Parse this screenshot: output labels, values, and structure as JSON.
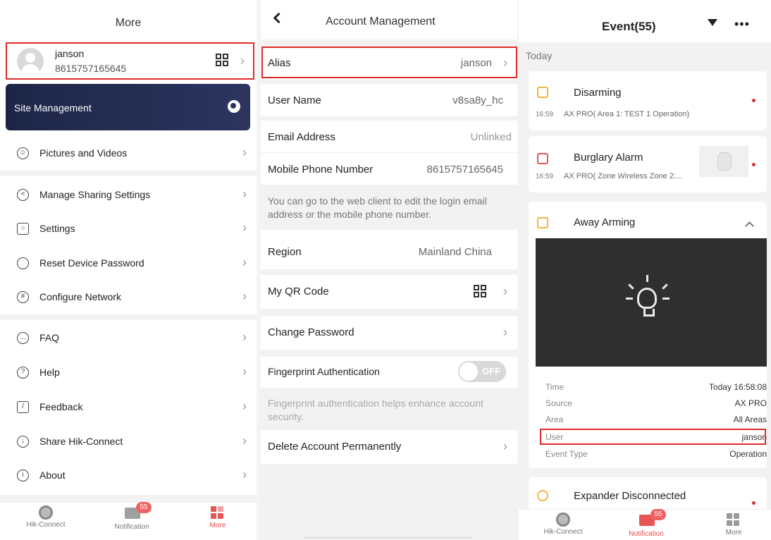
{
  "more_panel": {
    "title": "More",
    "profile": {
      "name": "janson",
      "phone": "8615757165645"
    },
    "site_management": "Site Management",
    "menu": [
      {
        "label": "Pictures and Videos",
        "icon": "image-icon"
      },
      {
        "label": "Manage Sharing Settings",
        "icon": "share-icon"
      },
      {
        "label": "Settings",
        "icon": "settings-icon"
      },
      {
        "label": "Reset Device Password",
        "icon": "reset-icon"
      },
      {
        "label": "Configure Network",
        "icon": "network-icon"
      },
      {
        "label": "FAQ",
        "icon": "faq-icon"
      },
      {
        "label": "Help",
        "icon": "help-icon"
      },
      {
        "label": "Feedback",
        "icon": "feedback-icon"
      },
      {
        "label": "Share Hik-Connect",
        "icon": "share-app-icon"
      },
      {
        "label": "About",
        "icon": "about-icon"
      }
    ],
    "tabs": [
      {
        "label": "Hik-Connect"
      },
      {
        "label": "Notification",
        "badge": "55"
      },
      {
        "label": "More"
      }
    ]
  },
  "account_panel": {
    "title": "Account Management",
    "alias": {
      "label": "Alias",
      "value": "janson"
    },
    "username": {
      "label": "User Name",
      "value": "v8sa8y_hc"
    },
    "email": {
      "label": "Email Address",
      "value": "Unlinked"
    },
    "mobile": {
      "label": "Mobile Phone Number",
      "value": "8615757165645"
    },
    "edit_note": "You can go to the web client to edit the login email address or the mobile phone number.",
    "region": {
      "label": "Region",
      "value": "Mainland China"
    },
    "qr": {
      "label": "My QR Code"
    },
    "change_password": "Change Password",
    "fingerprint": {
      "label": "Fingerprint Authentication",
      "state": "OFF"
    },
    "fingerprint_note": "Fingerprint authentication helps enhance account security.",
    "delete": "Delete Account Permanently"
  },
  "event_panel": {
    "title": "Event(55)",
    "section": "Today",
    "events": [
      {
        "title": "Disarming",
        "time": "16:59",
        "desc": "AX PRO( Area 1: TEST 1 Operation)"
      },
      {
        "title": "Burglary Alarm",
        "time": "16:59",
        "desc": "AX PRO( Zone Wireless Zone 2:..."
      },
      {
        "title": "Away Arming"
      },
      {
        "title": "Expander Disconnected"
      }
    ],
    "details": [
      {
        "key": "Time",
        "value": "Today 16:58:08"
      },
      {
        "key": "Source",
        "value": "AX PRO"
      },
      {
        "key": "Area",
        "value": "All Areas"
      },
      {
        "key": "User",
        "value": "janson"
      },
      {
        "key": "Event Type",
        "value": "Operation"
      }
    ],
    "tabs": [
      {
        "label": "Hik-Connect"
      },
      {
        "label": "Notification",
        "badge": "55"
      },
      {
        "label": "More"
      }
    ]
  },
  "colors": {
    "accent_red": "#e02a2a",
    "badge": "#f06262",
    "site_card": "#1d2547",
    "event_icon": "#f1b740"
  }
}
